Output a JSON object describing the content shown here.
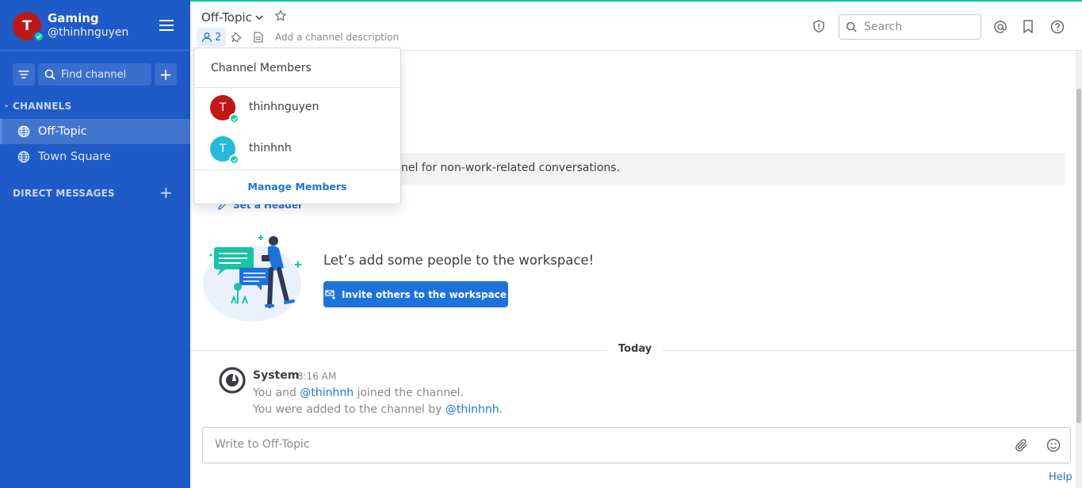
{
  "team": {
    "name": "Gaming",
    "user": "@thinhnguyen",
    "avatar_initial": "T",
    "avatar_color": "#c01717",
    "status": "online"
  },
  "sidebar": {
    "find_channel_placeholder": "Find channel",
    "channels_label": "CHANNELS",
    "channels": [
      {
        "label": "Off-Topic",
        "active": true,
        "icon": "globe-icon"
      },
      {
        "label": "Town Square",
        "active": false,
        "icon": "globe-icon"
      }
    ],
    "dm_label": "DIRECT MESSAGES",
    "background": "#1e5bc6"
  },
  "header": {
    "channel_name": "Off-Topic",
    "member_count": "2",
    "add_description": "Add a channel description",
    "search_placeholder": "Search"
  },
  "channel_intro": {
    "text": "nel for non-work-related conversations.",
    "set_header": "Set a Header"
  },
  "invite": {
    "title": "Let’s add some people to the workspace!",
    "button_label": "Invite others to the workspace"
  },
  "messages": {
    "date_separator": "Today",
    "system_post": {
      "author": "System",
      "time": "8:16 AM",
      "line1_prefix": "You and ",
      "line1_mention": "@thinhnh",
      "line1_suffix": " joined the channel.",
      "line2_prefix": "You were ",
      "line2_mid": "added to the channel",
      "line2_by": " by ",
      "line2_mention": "@thinhnh",
      "line2_end": "."
    }
  },
  "composer": {
    "placeholder": "Write to Off-Topic"
  },
  "help_link": "Help",
  "members_popover": {
    "title": "Channel Members",
    "members": [
      {
        "name": "thinhnguyen",
        "initial": "T",
        "color": "#c01717"
      },
      {
        "name": "thinhnh",
        "initial": "T",
        "color": "#26b9d9"
      }
    ],
    "manage_label": "Manage Members"
  },
  "colors": {
    "accent": "#1d73dc",
    "online": "#06d6a0",
    "topbar_accent": "#17c4a6"
  }
}
